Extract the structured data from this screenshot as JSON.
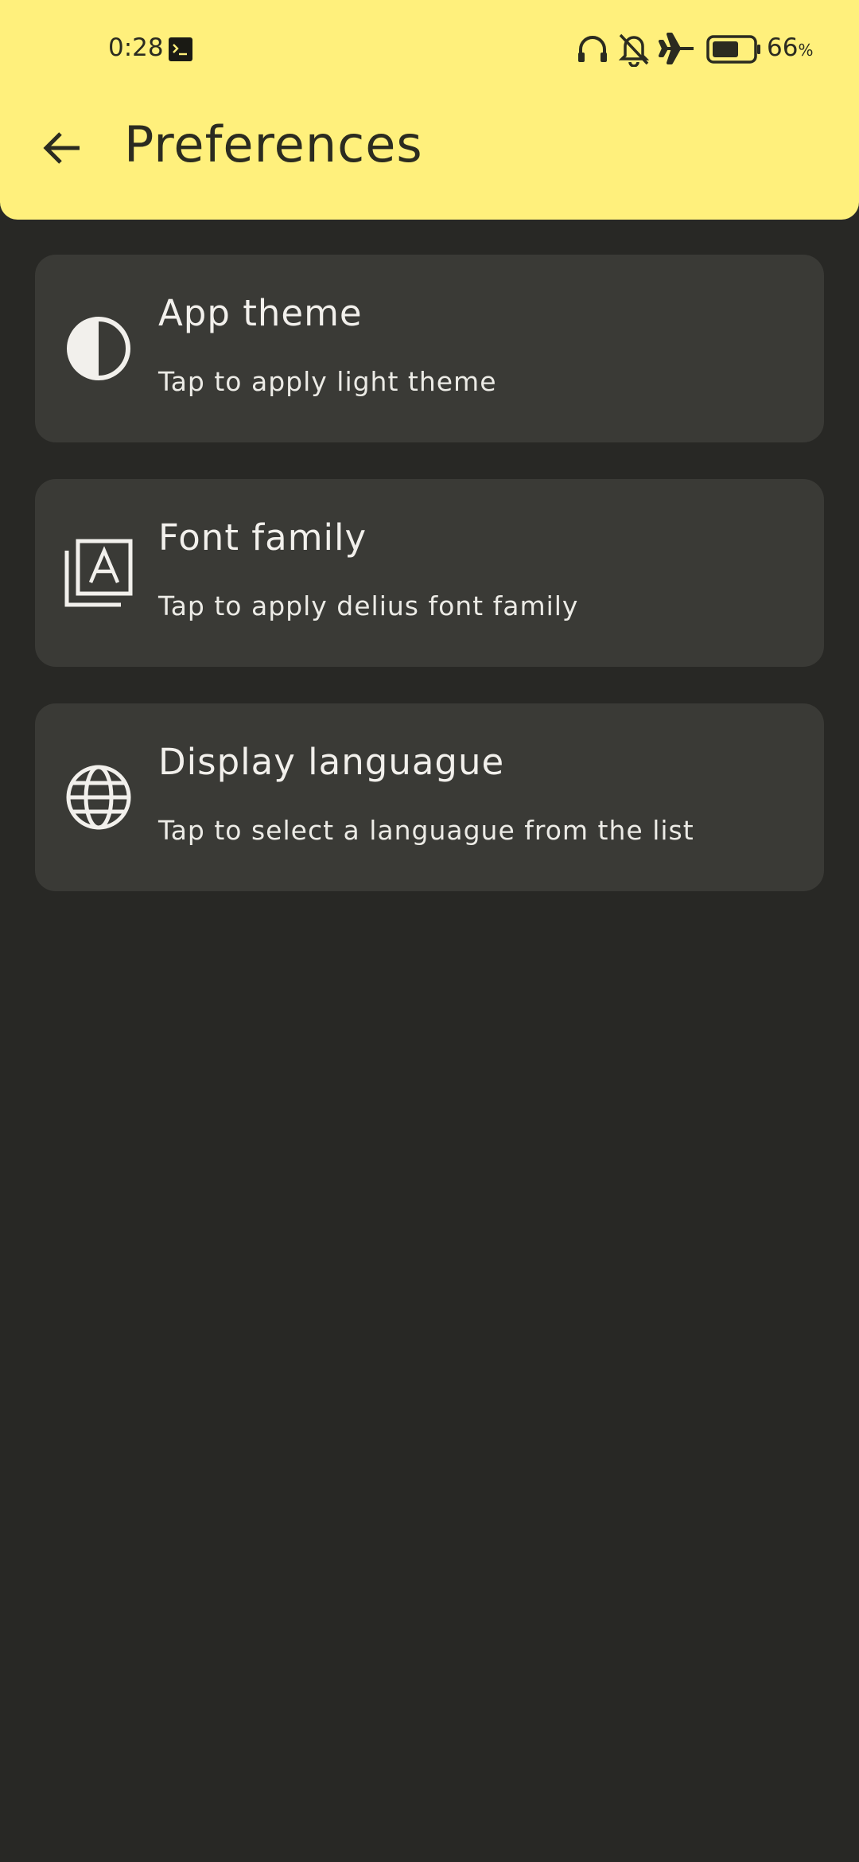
{
  "status_bar": {
    "time": "0:28",
    "battery_percent": "66",
    "battery_suffix": "%",
    "battery_level": 0.66,
    "icons": [
      "terminal-icon",
      "headset-icon",
      "bell-off-icon",
      "airplane-icon",
      "battery-icon"
    ]
  },
  "header": {
    "title": "Preferences",
    "back_icon": "arrow-back-icon",
    "background": "#fff07c"
  },
  "settings": [
    {
      "icon": "contrast-icon",
      "title": "App theme",
      "subtitle": "Tap to apply light theme"
    },
    {
      "icon": "font-icon",
      "title": "Font family",
      "subtitle": "Tap to apply delius font family"
    },
    {
      "icon": "globe-icon",
      "title": "Display languague",
      "subtitle": "Tap to select a languague from the list"
    }
  ],
  "colors": {
    "background": "#282825",
    "card": "#3a3a36",
    "text": "#f2f0ec"
  }
}
